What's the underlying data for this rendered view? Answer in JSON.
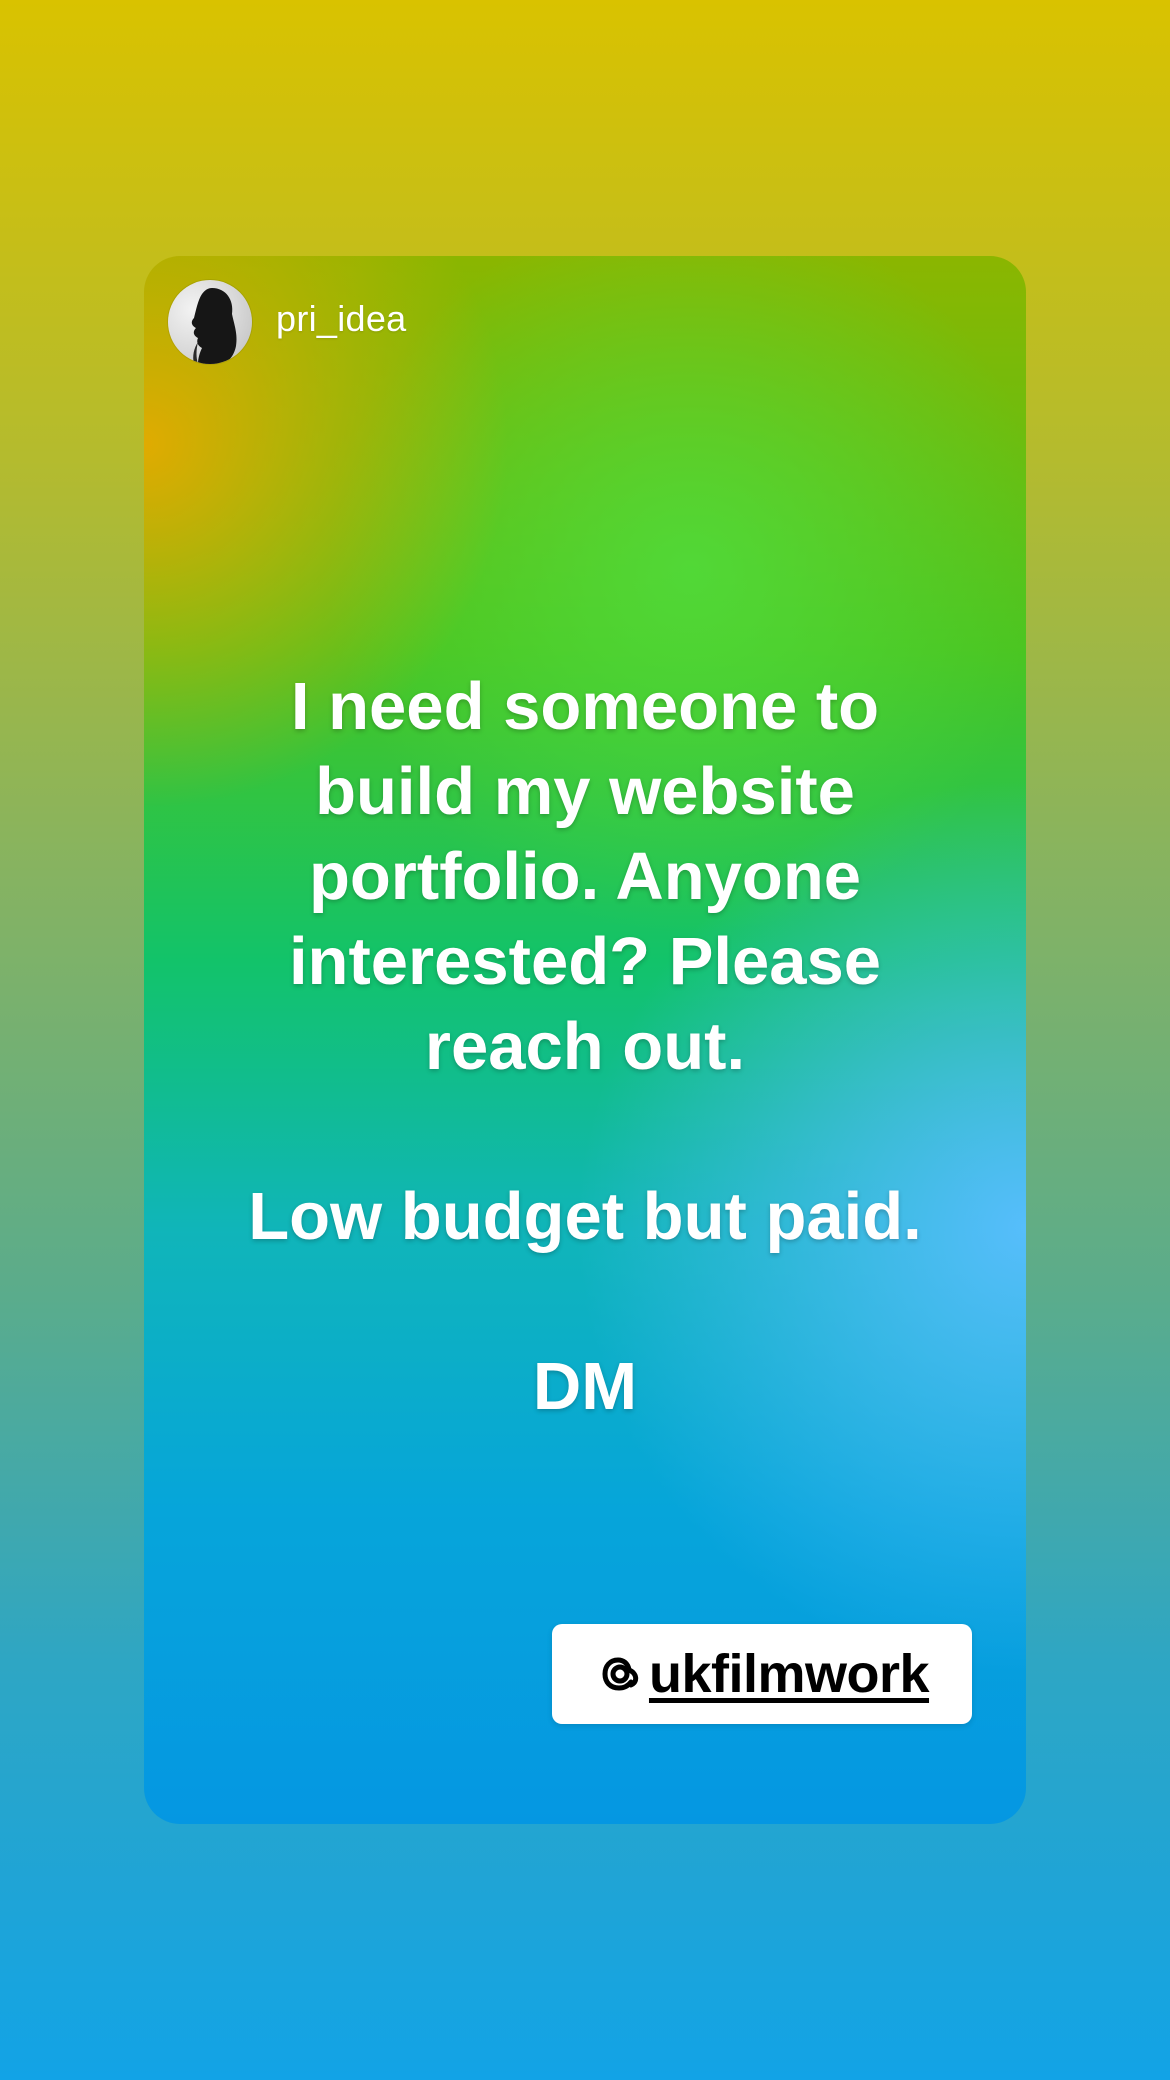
{
  "story": {
    "username": "pri_idea",
    "avatar_icon": "profile-silhouette-icon",
    "text_lines": [
      "I need someone to",
      "build my website",
      "portfolio.  Anyone",
      "interested? Please",
      "reach out.",
      "",
      "Low budget but paid.",
      "",
      "DM"
    ],
    "mention": {
      "icon": "threads-at-icon",
      "handle": "ukfilmwork"
    }
  },
  "colors": {
    "background_top": "#d9c200",
    "background_bottom": "#12a3e6",
    "card_accent_orange": "#e6aa00",
    "card_accent_green": "#12c36a",
    "card_accent_blue": "#5abeff",
    "text": "#ffffff",
    "sticker_bg": "#ffffff",
    "sticker_text": "#000000"
  }
}
